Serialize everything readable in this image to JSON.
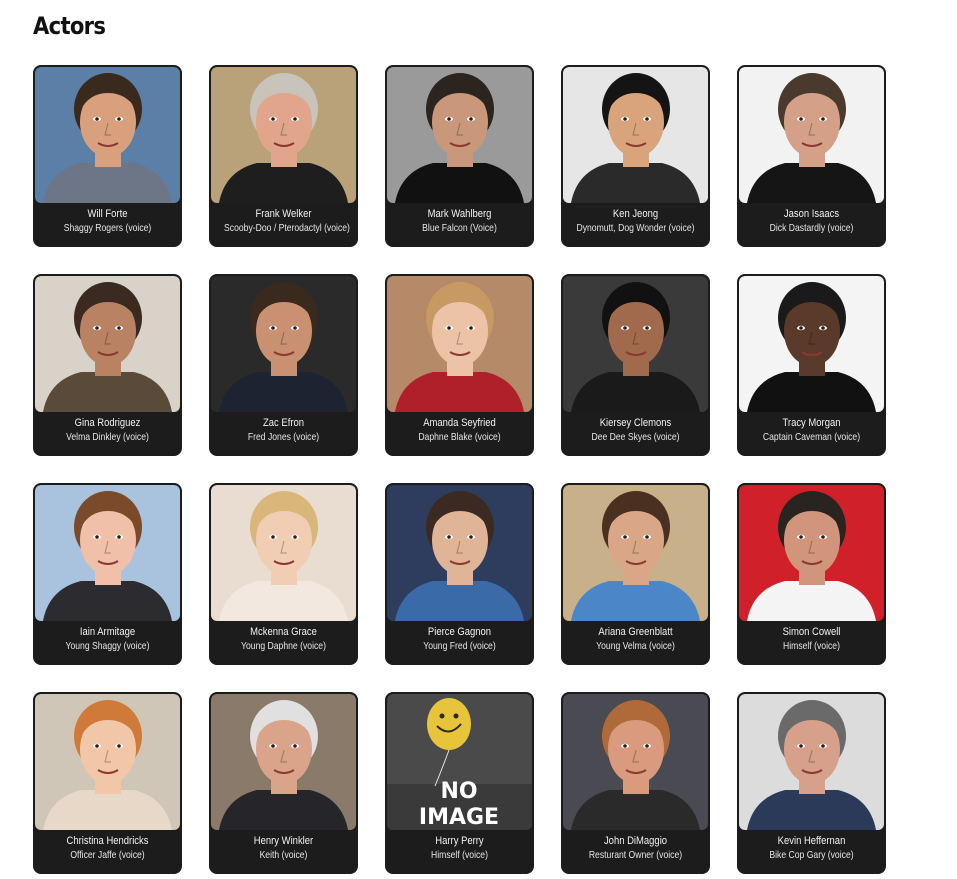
{
  "section": {
    "title": "Actors"
  },
  "actors": [
    {
      "name": "Will Forte",
      "role": "Shaggy Rogers (voice)",
      "bg": "#5b7fa6",
      "skin": "#d9a07e",
      "hair": "#3a2a1e",
      "shirt": "#6c7687"
    },
    {
      "name": "Frank Welker",
      "role": "Scooby-Doo / Pterodactyl (voice)",
      "bg": "#b9a27a",
      "skin": "#e0a58a",
      "hair": "#c8c3bb",
      "shirt": "#1e1e1e"
    },
    {
      "name": "Mark Wahlberg",
      "role": "Blue Falcon (Voice)",
      "bg": "#9a9a9a",
      "skin": "#c9977a",
      "hair": "#2b241f",
      "shirt": "#111111"
    },
    {
      "name": "Ken Jeong",
      "role": "Dynomutt, Dog Wonder (voice)",
      "bg": "#e6e6e6",
      "skin": "#d9a47c",
      "hair": "#141414",
      "shirt": "#2a2a2a"
    },
    {
      "name": "Jason Isaacs",
      "role": "Dick Dastardly (voice)",
      "bg": "#f2f2f2",
      "skin": "#d4a088",
      "hair": "#4a3a2e",
      "shirt": "#151515"
    },
    {
      "name": "Gina Rodriguez",
      "role": "Velma Dinkley (voice)",
      "bg": "#d8d2c8",
      "skin": "#b98363",
      "hair": "#3a2a20",
      "shirt": "#5a4a3a"
    },
    {
      "name": "Zac Efron",
      "role": "Fred Jones (voice)",
      "bg": "#2a2a2a",
      "skin": "#c99072",
      "hair": "#3a2a1e",
      "shirt": "#1d2330"
    },
    {
      "name": "Amanda Seyfried",
      "role": "Daphne Blake (voice)",
      "bg": "#b48a68",
      "skin": "#ecc3a6",
      "hair": "#c69a62",
      "shirt": "#b0202a"
    },
    {
      "name": "Kiersey Clemons",
      "role": "Dee Dee Skyes (voice)",
      "bg": "#3a3a3a",
      "skin": "#a26a4c",
      "hair": "#111111",
      "shirt": "#1a1a1a"
    },
    {
      "name": "Tracy Morgan",
      "role": "Captain Caveman (voice)",
      "bg": "#f4f4f4",
      "skin": "#5a3a2a",
      "hair": "#1a1a1a",
      "shirt": "#111111"
    },
    {
      "name": "Iain Armitage",
      "role": "Young Shaggy (voice)",
      "bg": "#a9c2dd",
      "skin": "#f0c0a8",
      "hair": "#7a4a2a",
      "shirt": "#2b2b30"
    },
    {
      "name": "Mckenna Grace",
      "role": "Young Daphne (voice)",
      "bg": "#e8ddd0",
      "skin": "#f1cdb4",
      "hair": "#d9b77a",
      "shirt": "#f3e8e0"
    },
    {
      "name": "Pierce Gagnon",
      "role": "Young Fred (voice)",
      "bg": "#2e3d5e",
      "skin": "#e0b497",
      "hair": "#3a2a22",
      "shirt": "#3b6aa8"
    },
    {
      "name": "Ariana Greenblatt",
      "role": "Young Velma (voice)",
      "bg": "#c8b08a",
      "skin": "#d9a787",
      "hair": "#4a3020",
      "shirt": "#4a86c8"
    },
    {
      "name": "Simon Cowell",
      "role": "Himself (voice)",
      "bg": "#d0202a",
      "skin": "#d0957a",
      "hair": "#2a2420",
      "shirt": "#f4f4f4"
    },
    {
      "name": "Christina Hendricks",
      "role": "Officer Jaffe (voice)",
      "bg": "#cfc6b8",
      "skin": "#f1c7a8",
      "hair": "#d07a3a",
      "shirt": "#e8d8c8"
    },
    {
      "name": "Henry Winkler",
      "role": "Keith (voice)",
      "bg": "#8a7a6a",
      "skin": "#d9a489",
      "hair": "#e0e0e0",
      "shirt": "#25252a"
    },
    {
      "name": "Harry Perry",
      "role": "Himself (voice)",
      "noimage": true,
      "noimage_line1": "NO",
      "noimage_line2": "IMAGE",
      "bg": "#4a4a4a",
      "skin": "#e8c43a",
      "hair": "#e8c43a",
      "shirt": "#3a3a3a"
    },
    {
      "name": "John DiMaggio",
      "role": "Resturant Owner (voice)",
      "bg": "#4a4a52",
      "skin": "#d99a7e",
      "hair": "#b06a3a",
      "shirt": "#2a2a2a"
    },
    {
      "name": "Kevin Heffernan",
      "role": "Bike Cop Gary (voice)",
      "bg": "#dcdcdc",
      "skin": "#d6a08a",
      "hair": "#6a6a6a",
      "shirt": "#2c3a5a"
    }
  ]
}
